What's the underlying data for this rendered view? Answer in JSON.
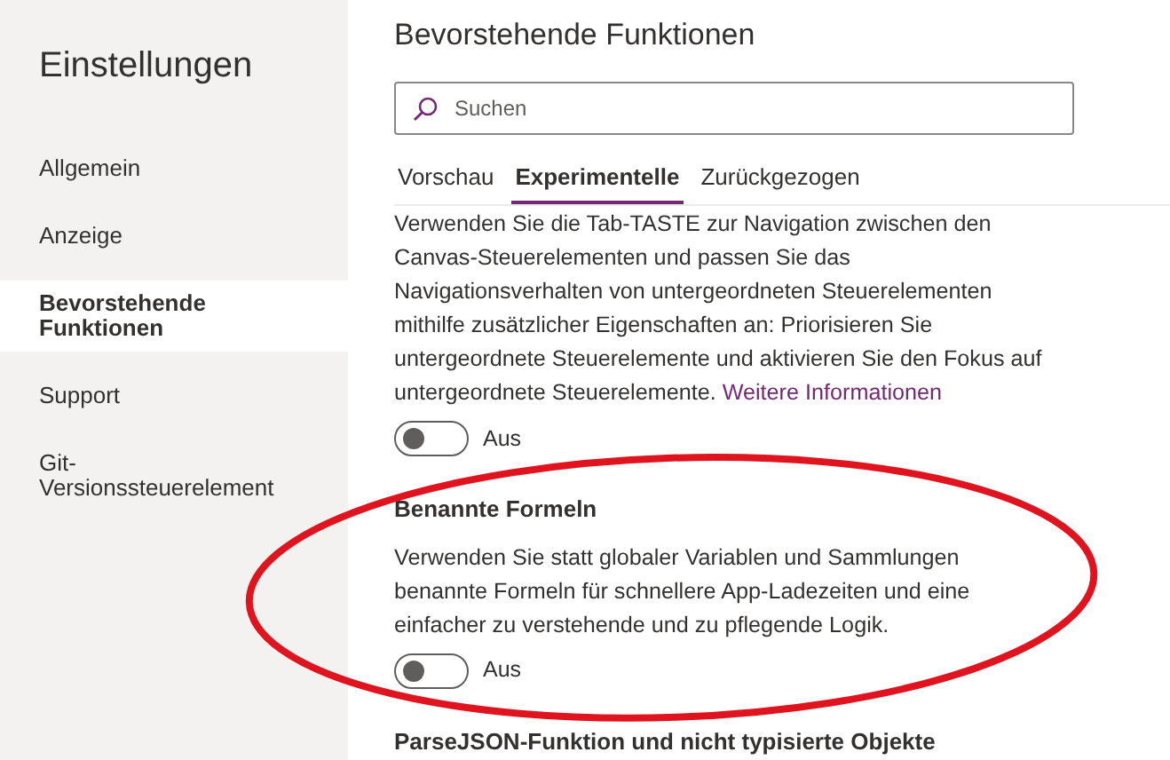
{
  "sidebar": {
    "title": "Einstellungen",
    "items": [
      {
        "label": "Allgemein",
        "selected": false
      },
      {
        "label": "Anzeige",
        "selected": false
      },
      {
        "label": "Bevorstehende Funktionen",
        "selected": true
      },
      {
        "label": "Support",
        "selected": false
      },
      {
        "label": "Git-Versionssteuerelement",
        "selected": false
      }
    ]
  },
  "page": {
    "title": "Bevorstehende Funktionen",
    "search": {
      "placeholder": "Suchen"
    },
    "tabs": [
      {
        "label": "Vorschau",
        "selected": false
      },
      {
        "label": "Experimentelle",
        "selected": true
      },
      {
        "label": "Zurückgezogen",
        "selected": false
      }
    ],
    "features": [
      {
        "description": "Verwenden Sie die Tab-TASTE zur Navigation zwischen den Canvas-Steuerelementen und passen Sie das Navigationsverhalten von untergeordneten Steuerelementen mithilfe zusätzlicher Eigenschaften an: Priorisieren Sie untergeordnete Steuerelemente und aktivieren Sie den Fokus auf untergeordnete Steuerelemente.",
        "link": "Weitere Informationen",
        "on": false,
        "toggle_label": "Aus"
      },
      {
        "title": "Benannte Formeln",
        "description": "Verwenden Sie statt globaler Variablen und Sammlungen benannte Formeln für schnellere App-Ladezeiten und eine einfacher zu verstehende und zu pflegende Logik.",
        "on": false,
        "toggle_label": "Aus"
      },
      {
        "title": "ParseJSON-Funktion und nicht typisierte Objekte"
      }
    ]
  },
  "highlight": {
    "kind": "ellipse"
  }
}
